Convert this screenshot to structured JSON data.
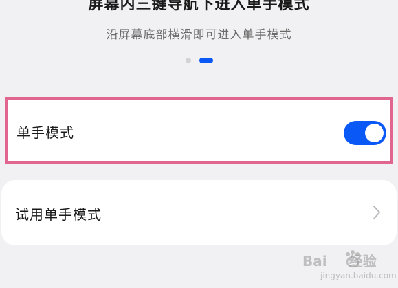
{
  "header": {
    "title": "屏幕内三键导航下进入单手模式",
    "subtitle": "沿屏幕底部横滑即可进入单手模式",
    "pager": {
      "pages": 2,
      "active_index": 1
    }
  },
  "settings": {
    "one_hand_mode": {
      "label": "单手模式",
      "enabled": true
    },
    "try_one_hand_mode": {
      "label": "试用单手模式"
    }
  },
  "watermark": {
    "brand_left": "Bai",
    "brand_right": "经验",
    "url": "jingyan.baidu.com"
  },
  "colors": {
    "accent": "#0a59f7",
    "highlight_border": "#e0668f",
    "background": "#f1f1f3"
  },
  "icons": {
    "toggle": "toggle-switch-on",
    "chevron": "chevron-right-icon",
    "watermark_logo": "paw-icon"
  }
}
